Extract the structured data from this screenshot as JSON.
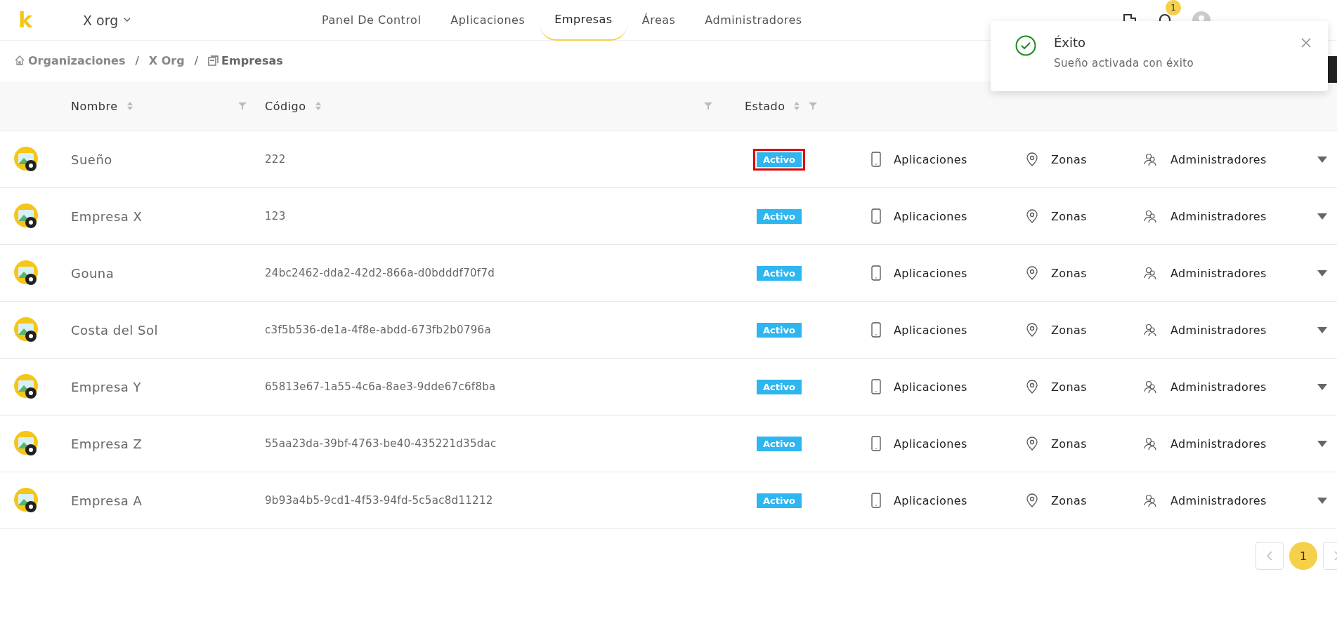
{
  "header": {
    "logo": "k",
    "org": "X org",
    "nav": [
      {
        "label": "Panel De Control",
        "selected": false
      },
      {
        "label": "Aplicaciones",
        "selected": false
      },
      {
        "label": "Empresas",
        "selected": true
      },
      {
        "label": "Áreas",
        "selected": false
      },
      {
        "label": "Administradores",
        "selected": false
      }
    ],
    "notification_count": "1"
  },
  "breadcrumb": [
    {
      "label": "Organizaciones"
    },
    {
      "separator": "/",
      "label": "X Org"
    },
    {
      "separator": "/",
      "label": "Empresas"
    }
  ],
  "table": {
    "columns": [
      {
        "label": "Nombre"
      },
      {
        "label": "Código"
      },
      {
        "label": "Estado"
      }
    ],
    "rows": [
      {
        "name": "Sueño",
        "code": "222",
        "status": "Activo",
        "highlighted": true,
        "apps": "Aplicaciones",
        "zones": "Zonas",
        "admins": "Administradores"
      },
      {
        "name": "Empresa X",
        "code": "123",
        "status": "Activo",
        "highlighted": false,
        "apps": "Aplicaciones",
        "zones": "Zonas",
        "admins": "Administradores"
      },
      {
        "name": "Gouna",
        "code": "24bc2462-dda2-42d2-866a-d0bdddf70f7d",
        "status": "Activo",
        "highlighted": false,
        "apps": "Aplicaciones",
        "zones": "Zonas",
        "admins": "Administradores"
      },
      {
        "name": "Costa del Sol",
        "code": "c3f5b536-de1a-4f8e-abdd-673fb2b0796a",
        "status": "Activo",
        "highlighted": false,
        "apps": "Aplicaciones",
        "zones": "Zonas",
        "admins": "Administradores"
      },
      {
        "name": "Empresa Y",
        "code": "65813e67-1a55-4c6a-8ae3-9dde67c6f8ba",
        "status": "Activo",
        "highlighted": false,
        "apps": "Aplicaciones",
        "zones": "Zonas",
        "admins": "Administradores"
      },
      {
        "name": "Empresa Z",
        "code": "55aa23da-39bf-4763-be40-435221d35dac",
        "status": "Activo",
        "highlighted": false,
        "apps": "Aplicaciones",
        "zones": "Zonas",
        "admins": "Administradores"
      },
      {
        "name": "Empresa A",
        "code": "9b93a4b5-9cd1-4f53-94fd-5c5ac8d11212",
        "status": "Activo",
        "highlighted": false,
        "apps": "Aplicaciones",
        "zones": "Zonas",
        "admins": "Administradores"
      }
    ]
  },
  "pagination": {
    "pages": [
      {
        "label": "1",
        "selected": true
      }
    ]
  },
  "toast": {
    "kind": "success",
    "title": "Éxito",
    "message": "Sueño activada con éxito"
  }
}
